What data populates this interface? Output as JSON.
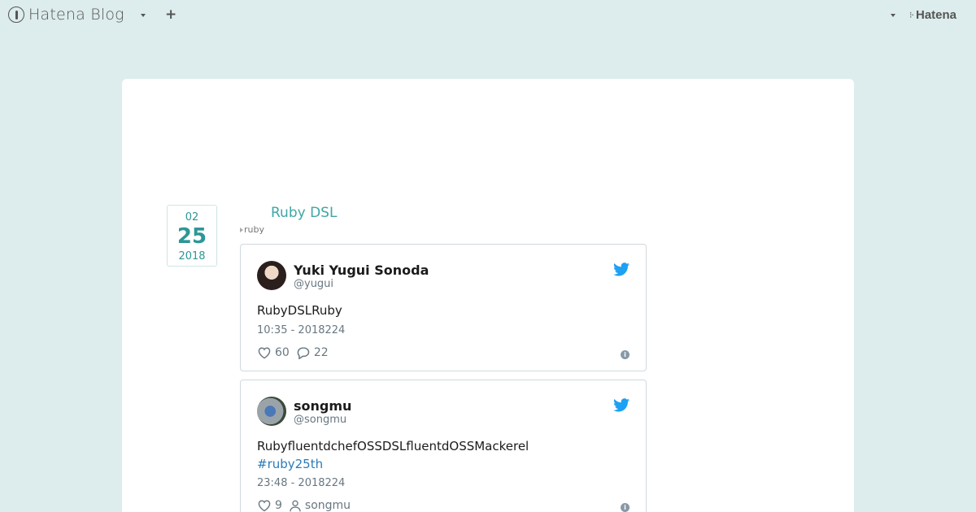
{
  "topbar": {
    "brand_name": "Hatena Blog",
    "add_label": "+",
    "hatena_label": "Hatena"
  },
  "entry": {
    "date": {
      "month": "02",
      "day": "25",
      "year": "2018"
    },
    "title": "Ruby DSL",
    "category": "ruby"
  },
  "tweets": [
    {
      "name": "Yuki Yugui Sonoda",
      "handle": "@yugui",
      "text": "RubyDSLRuby",
      "hashtag": "",
      "time": "10:35 - 2018224",
      "likes": "60",
      "second_action": "22",
      "second_action_icon": "reply-bubble-icon"
    },
    {
      "name": "songmu",
      "handle": "@songmu",
      "text": "RubyfluentdchefOSSDSLfluentdOSSMackerel",
      "hashtag": "#ruby25th",
      "time": "23:48 - 2018224",
      "likes": "9",
      "second_action": "songmu",
      "second_action_icon": "person-icon"
    }
  ],
  "colors": {
    "page_bg": "#ddecec",
    "accent": "#3fa6a6",
    "twitter_blue": "#1da1f2",
    "hashtag": "#2b7bb9"
  }
}
